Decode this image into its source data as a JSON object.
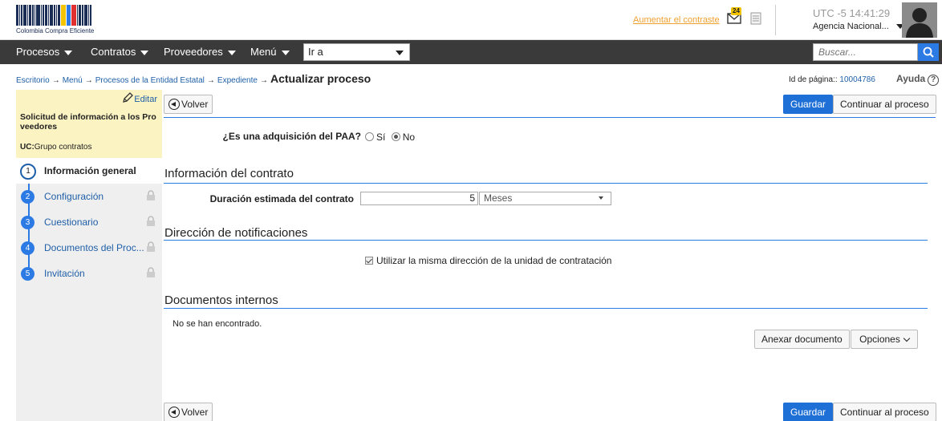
{
  "header": {
    "logo_text": "Colombia Compra Eficiente",
    "contrast_link": "Aumentar el contraste",
    "mail_count": "24",
    "timezone": "UTC -5",
    "time": "14:41:29",
    "agency": "Agencia Nacional..."
  },
  "nav": {
    "items": [
      "Procesos",
      "Contratos",
      "Proveedores",
      "Menú"
    ],
    "goto_label": "Ir a",
    "search_placeholder": "Buscar..."
  },
  "breadcrumb": {
    "items": [
      "Escritorio",
      "Menú",
      "Procesos de la Entidad Estatal",
      "Expediente"
    ],
    "arrow": "→",
    "current": "Actualizar proceso",
    "page_id_label": "Id de página::",
    "page_id": "10004786",
    "help": "Ayuda",
    "help_symbol": "?"
  },
  "sidebar": {
    "edit": "Editar",
    "process_name": "Solicitud de información a los Pro veedores",
    "uc_label": "UC:",
    "uc_value": "Grupo contratos",
    "steps": [
      {
        "num": "1",
        "label": "Información general"
      },
      {
        "num": "2",
        "label": "Configuración"
      },
      {
        "num": "3",
        "label": "Cuestionario"
      },
      {
        "num": "4",
        "label": "Documentos del Proc..."
      },
      {
        "num": "5",
        "label": "Invitación"
      }
    ]
  },
  "actions": {
    "back": "Volver",
    "save": "Guardar",
    "continue": "Continuar al proceso",
    "attach": "Anexar documento",
    "options": "Opciones"
  },
  "form": {
    "paa_label": "¿Es una adquisición del PAA?",
    "paa_yes": "Sí",
    "paa_no": "No",
    "paa_selected": "No",
    "contract_section": "Información del contrato",
    "duration_label": "Duración estimada del contrato",
    "duration_value": "5",
    "duration_unit": "Meses",
    "notif_section": "Dirección de notificaciones",
    "same_address_label": "Utilizar la misma dirección de la unidad de contratación",
    "docs_section": "Documentos internos",
    "docs_empty": "No se han encontrado."
  },
  "colors": {
    "accent": "#1f70d6",
    "navbar": "#3a3a3a",
    "sidebar_highlight": "#fbf3c2",
    "link": "#1f5fa8",
    "contrast_link": "#f0a030"
  }
}
